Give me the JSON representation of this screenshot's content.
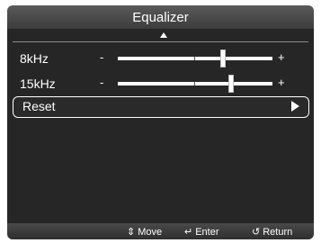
{
  "title": "Equalizer",
  "rows": [
    {
      "label": "8kHz",
      "minus": "-",
      "plus": "+",
      "level": 0.68
    },
    {
      "label": "15kHz",
      "minus": "-",
      "plus": "+",
      "level": 0.73
    }
  ],
  "reset": {
    "label": "Reset",
    "arrow_icon": "triangle-right-icon"
  },
  "footer": {
    "move": {
      "icon": "up-down-icon",
      "glyph": "⇕",
      "label": "Move"
    },
    "enter": {
      "icon": "enter-icon",
      "glyph": "↵",
      "label": "Enter"
    },
    "return": {
      "icon": "return-icon",
      "glyph": "↺",
      "label": "Return"
    }
  },
  "colors": {
    "panel": "#262626",
    "title_bar": "#4a4a4a",
    "text": "#ffffff"
  }
}
